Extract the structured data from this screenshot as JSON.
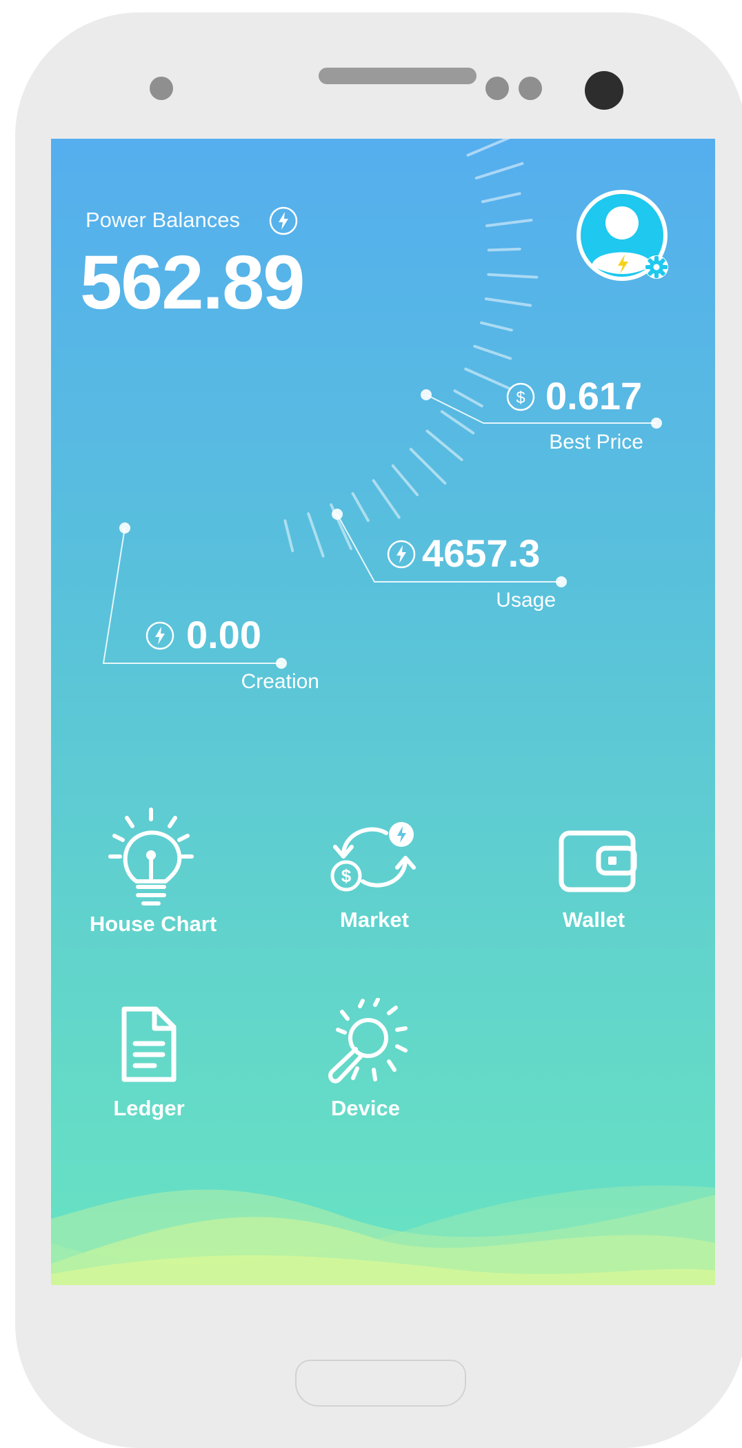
{
  "balance": {
    "label": "Power Balances",
    "value": "562.89"
  },
  "stats": {
    "best_price": {
      "value": "0.617",
      "label": "Best Price",
      "icon": "dollar-icon"
    },
    "usage": {
      "value": "4657.3",
      "label": "Usage",
      "icon": "lightning-icon"
    },
    "creation": {
      "value": "0.00",
      "label": "Creation",
      "icon": "lightning-icon"
    }
  },
  "menu": {
    "house_chart": "House Chart",
    "market": "Market",
    "wallet": "Wallet",
    "ledger": "Ledger",
    "device": "Device"
  },
  "colors": {
    "gradient_top": "#55aeee",
    "gradient_bottom": "#68e3c2",
    "avatar_ring": "#1ec8ee",
    "bolt": "#f5d21a"
  }
}
